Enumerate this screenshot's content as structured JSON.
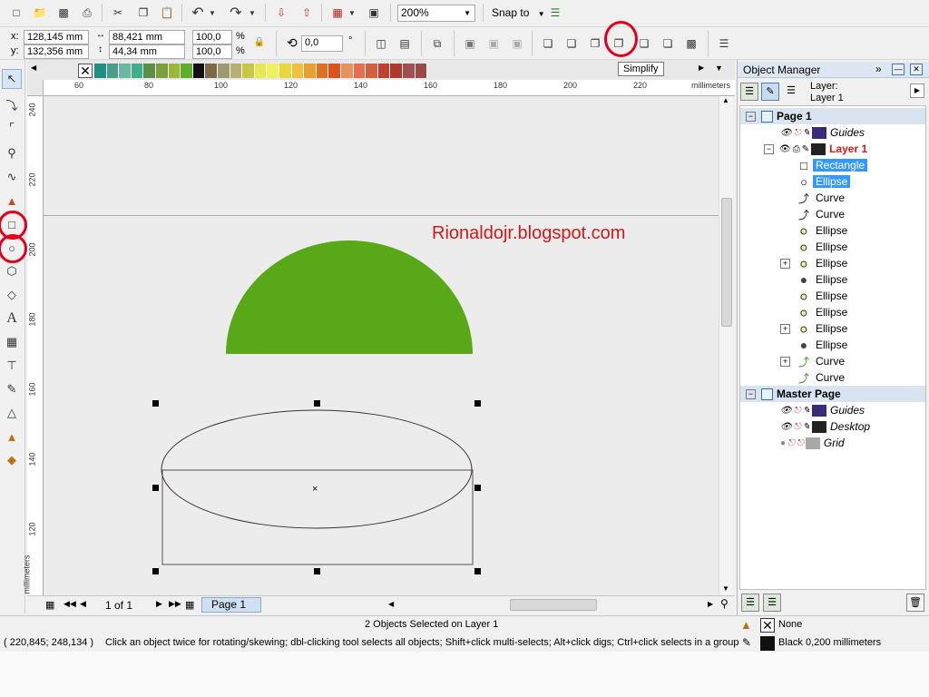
{
  "toolbar": {
    "zoom_value": "200%",
    "snap_label": "Snap to"
  },
  "property_bar": {
    "x_label": "x:",
    "y_label": "y:",
    "x_value": "128,145 mm",
    "y_value": "132,356 mm",
    "width_value": "88,421 mm",
    "height_value": "44,34 mm",
    "scale_x": "100,0",
    "scale_y": "100,0",
    "percent": "%",
    "rotation_value": "0,0",
    "degree": "°",
    "tooltip": "Simplify"
  },
  "palette": {
    "colors": [
      "#1f8f82",
      "#4a9d8a",
      "#6bb8a0",
      "#3fae8a",
      "#5a8f4a",
      "#7aa03c",
      "#98b83c",
      "#5fae2a",
      "#111111",
      "#7a6a48",
      "#a09870",
      "#b8b070",
      "#c8c848",
      "#e8e850",
      "#f0f060",
      "#e8d840",
      "#f0c040",
      "#e8a030",
      "#e07020",
      "#e05020",
      "#e89060",
      "#e07050",
      "#d06040",
      "#c04030",
      "#b03828",
      "#a05050",
      "#9a4a48"
    ]
  },
  "ruler": {
    "unit_label": "millimeters",
    "h_ticks": [
      "60",
      "80",
      "100",
      "120",
      "140",
      "160",
      "180",
      "200",
      "220"
    ],
    "v_ticks": [
      "240",
      "220",
      "200",
      "180",
      "160",
      "140",
      "120"
    ],
    "v_unit_label": "millimeters"
  },
  "canvas": {
    "watermark": "Rionaldojr.blogspot.com",
    "semicircle_color": "#58a818"
  },
  "page_nav": {
    "page_count": "1 of 1",
    "page_tab": "Page 1"
  },
  "object_manager": {
    "title": "Object Manager",
    "layer_label": "Layer:",
    "layer_name": "Layer 1",
    "page1": "Page 1",
    "guides": "Guides",
    "layer1": "Layer 1",
    "items": [
      {
        "label": "Rectangle",
        "icon": "rectangle-icon",
        "selected": true,
        "expander": false
      },
      {
        "label": "Ellipse",
        "icon": "ellipse-outline-icon",
        "selected": true,
        "expander": false
      },
      {
        "label": "Curve",
        "icon": "curve-black-icon",
        "selected": false,
        "expander": false
      },
      {
        "label": "Curve",
        "icon": "curve-black-icon",
        "selected": false,
        "expander": false
      },
      {
        "label": "Ellipse",
        "icon": "ellipse-yellow-icon",
        "selected": false,
        "expander": false
      },
      {
        "label": "Ellipse",
        "icon": "ellipse-yellow-icon",
        "selected": false,
        "expander": false
      },
      {
        "label": "Ellipse",
        "icon": "ellipse-yellow-icon",
        "selected": false,
        "expander": true
      },
      {
        "label": "Ellipse",
        "icon": "ellipse-dark-icon",
        "selected": false,
        "expander": false
      },
      {
        "label": "Ellipse",
        "icon": "ellipse-yellow-icon",
        "selected": false,
        "expander": false
      },
      {
        "label": "Ellipse",
        "icon": "ellipse-yellow-icon",
        "selected": false,
        "expander": false
      },
      {
        "label": "Ellipse",
        "icon": "ellipse-yellow-icon",
        "selected": false,
        "expander": true
      },
      {
        "label": "Ellipse",
        "icon": "ellipse-dark-icon",
        "selected": false,
        "expander": false
      },
      {
        "label": "Curve",
        "icon": "curve-green-icon",
        "selected": false,
        "expander": true
      },
      {
        "label": "Curve",
        "icon": "curve-green-icon",
        "selected": false,
        "expander": false
      }
    ],
    "master_page": "Master Page",
    "master_guides": "Guides",
    "master_desktop": "Desktop",
    "master_grid": "Grid"
  },
  "status": {
    "selection": "2 Objects Selected on Layer 1",
    "coords": "( 220,845; 248,134 )",
    "hint": "Click an object twice for rotating/skewing; dbl-clicking tool selects all objects; Shift+click multi-selects; Alt+click digs; Ctrl+click selects in a group",
    "fill_label": "None",
    "outline_label": "Black  0,200 millimeters"
  }
}
